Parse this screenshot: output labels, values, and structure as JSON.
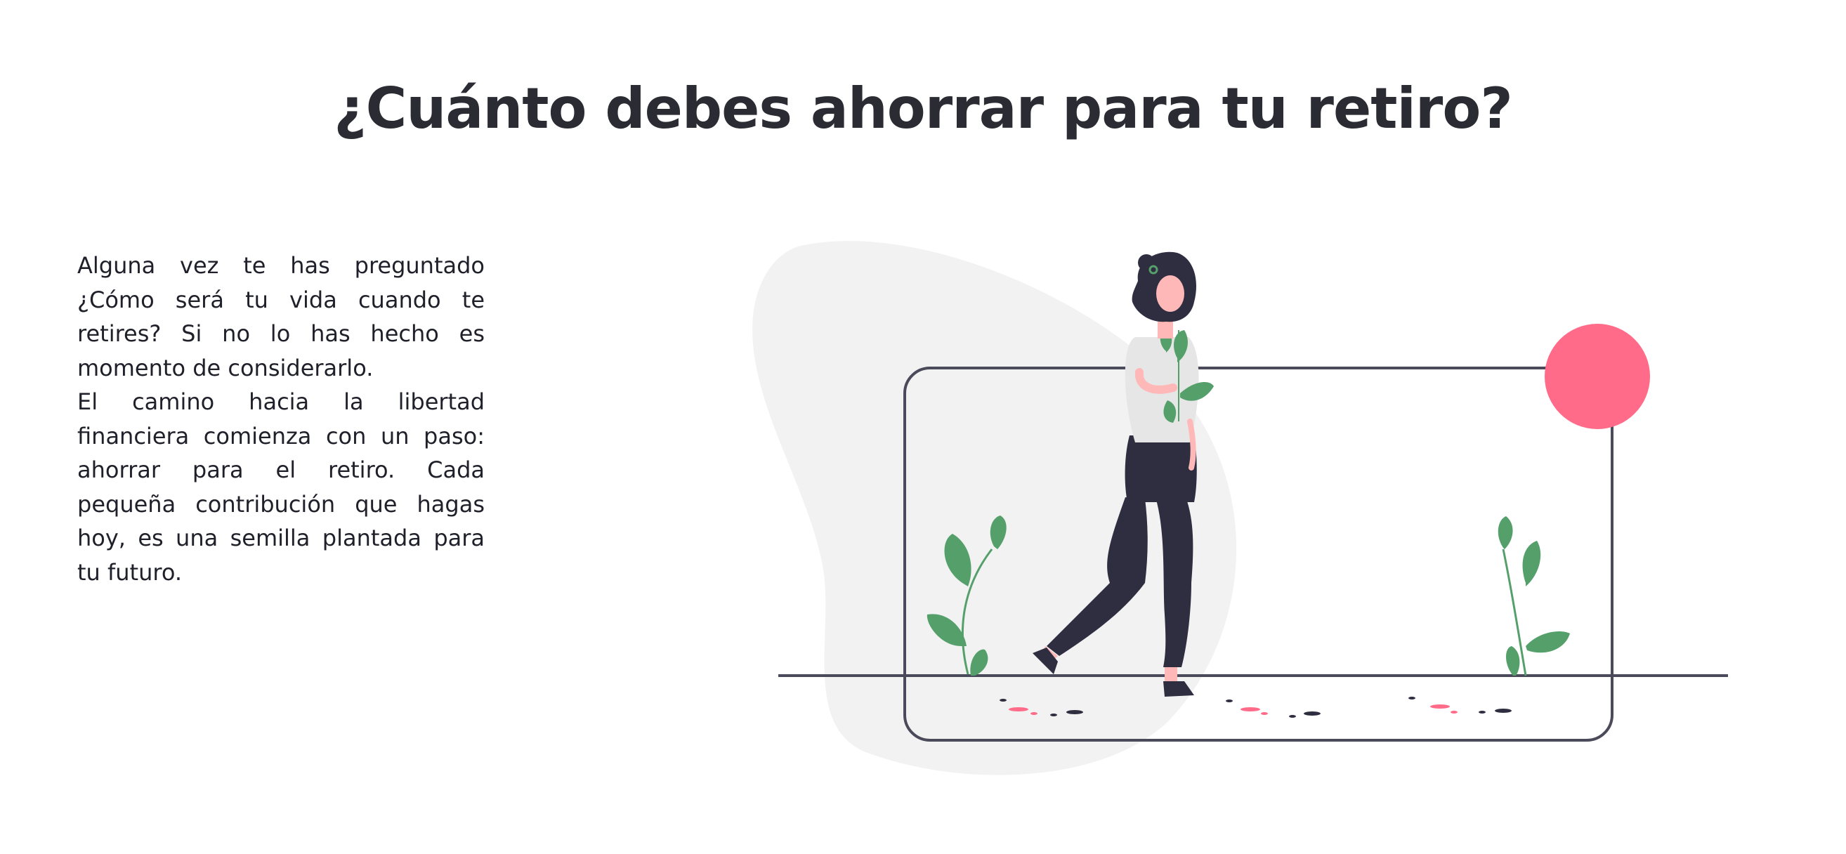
{
  "heading": {
    "title": "¿Cuánto debes ahorrar para tu retiro?"
  },
  "intro": {
    "paragraph1": "Alguna vez te has preguntado ¿Cómo será tu vida cuando te retires? Si no lo has hecho es momento de considerarlo.",
    "paragraph2": "El camino hacia la libertad financiera comienza con un paso: ahorrar para el retiro. Cada pequeña contribución que hagas hoy, es una semilla plantada para tu futuro."
  },
  "illustration": {
    "icon": "woman-holding-plant-illustration",
    "colors": {
      "blob": "#f2f2f2",
      "frame": "#4a4a5a",
      "sun": "#ff6b88",
      "leaf": "#55a06a",
      "pants": "#2f2e41",
      "skin": "#ffb8b8",
      "shirt": "#e6e6e6"
    }
  }
}
